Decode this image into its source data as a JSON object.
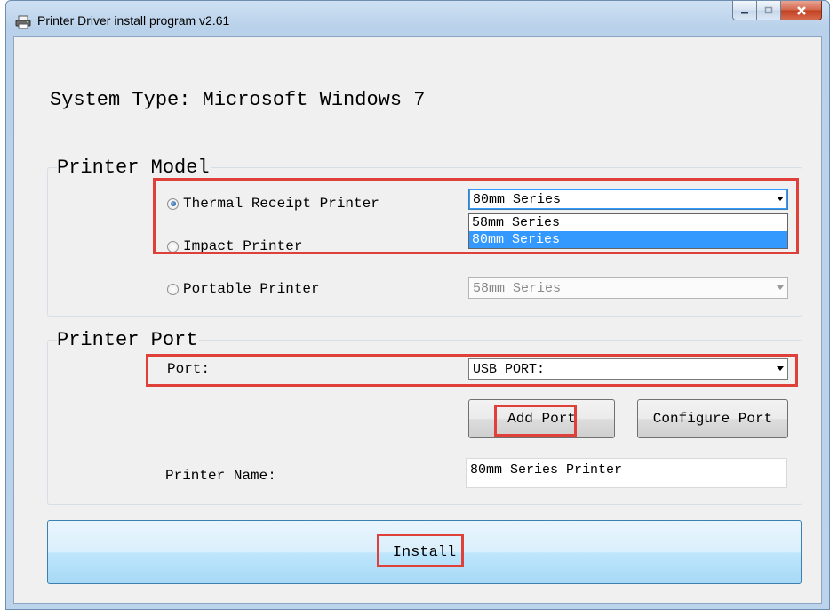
{
  "window": {
    "title": "Printer Driver install program v2.61"
  },
  "system_type": "System Type: Microsoft Windows 7",
  "printer_model": {
    "group_label": "Printer Model",
    "options": [
      {
        "label": "Thermal Receipt Printer",
        "checked": true,
        "series_value": "80mm Series"
      },
      {
        "label": "Impact Printer",
        "checked": false
      },
      {
        "label": "Portable Printer",
        "checked": false,
        "series_value": "58mm Series"
      }
    ],
    "dropdown_items": [
      "58mm Series",
      "80mm Series"
    ],
    "dropdown_selected": "80mm Series"
  },
  "printer_port": {
    "group_label": "Printer Port",
    "port_label": "Port:",
    "port_value": "USB PORT:",
    "add_port_label": "Add Port",
    "configure_port_label": "Configure Port",
    "printer_name_label": "Printer Name:",
    "printer_name_value": "80mm Series Printer"
  },
  "install_label": "Install",
  "colors": {
    "highlight": "#e0403a",
    "selection": "#3399ff",
    "install_button": "#bee6fd"
  }
}
